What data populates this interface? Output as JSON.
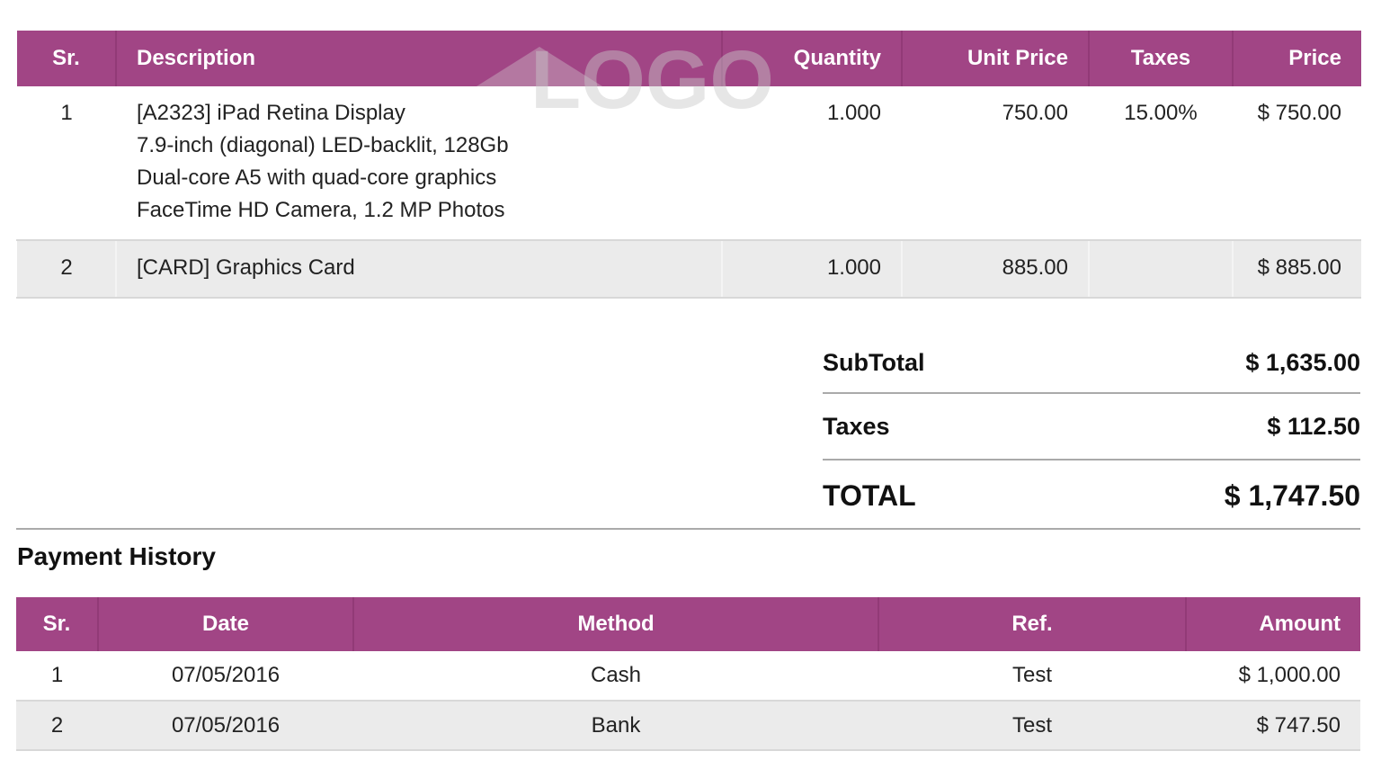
{
  "lines": {
    "headers": {
      "sr": "Sr.",
      "description": "Description",
      "quantity": "Quantity",
      "unit_price": "Unit Price",
      "taxes": "Taxes",
      "price": "Price"
    },
    "rows": [
      {
        "sr": "1",
        "description": [
          "[A2323] iPad Retina Display",
          "7.9-inch (diagonal) LED-backlit, 128Gb",
          "Dual-core A5 with quad-core graphics",
          "FaceTime HD Camera, 1.2 MP Photos"
        ],
        "quantity": "1.000",
        "unit_price": "750.00",
        "taxes": "15.00%",
        "price": "$ 750.00"
      },
      {
        "sr": "2",
        "description": [
          "[CARD] Graphics Card"
        ],
        "quantity": "1.000",
        "unit_price": "885.00",
        "taxes": "",
        "price": "$ 885.00"
      }
    ]
  },
  "watermark": {
    "text": "LOGO"
  },
  "totals": {
    "subtotal_label": "SubTotal",
    "subtotal_value": "$ 1,635.00",
    "taxes_label": "Taxes",
    "taxes_value": "$ 112.50",
    "total_label": "TOTAL",
    "total_value": "$ 1,747.50"
  },
  "payment_history": {
    "title": "Payment History",
    "headers": {
      "sr": "Sr.",
      "date": "Date",
      "method": "Method",
      "ref": "Ref.",
      "amount": "Amount"
    },
    "rows": [
      {
        "sr": "1",
        "date": "07/05/2016",
        "method": "Cash",
        "ref": "Test",
        "amount": "$ 1,000.00"
      },
      {
        "sr": "2",
        "date": "07/05/2016",
        "method": "Bank",
        "ref": "Test",
        "amount": "$ 747.50"
      }
    ]
  },
  "colors": {
    "header_bg": "#a14585",
    "header_text": "#ffffff",
    "row_alt_bg": "#ebebeb"
  }
}
